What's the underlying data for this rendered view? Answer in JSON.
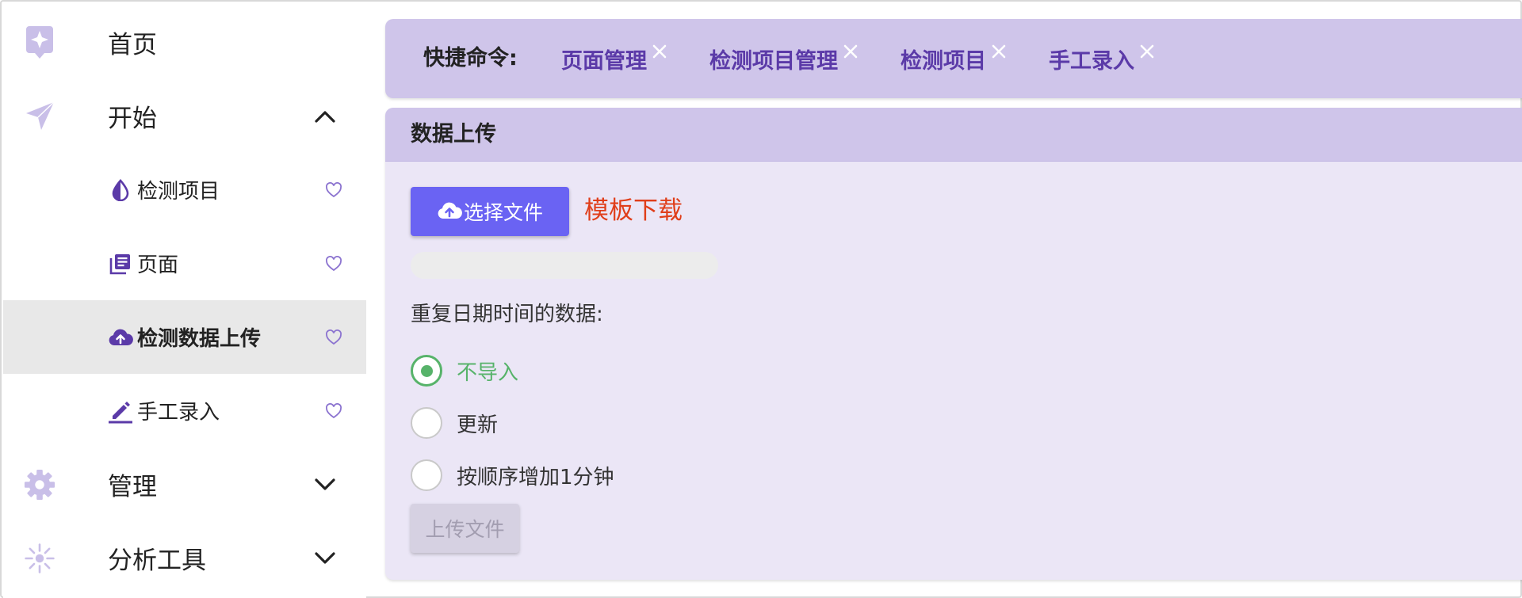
{
  "sidebar": {
    "top_items": [
      {
        "label": "首页",
        "icon": "sparkle-badge-icon"
      },
      {
        "label": "开始",
        "icon": "send-arrow-icon",
        "expanded": true
      },
      {
        "label": "管理",
        "icon": "gear-icon",
        "expanded": false
      },
      {
        "label": "分析工具",
        "icon": "sun-burst-icon",
        "expanded": false
      }
    ],
    "sub_items": [
      {
        "label": "检测项目",
        "icon": "contrast-drop-icon",
        "active": false
      },
      {
        "label": "页面",
        "icon": "library-books-icon",
        "active": false
      },
      {
        "label": "检测数据上传",
        "icon": "cloud-upload-icon",
        "active": true
      },
      {
        "label": "手工录入",
        "icon": "edit-pen-icon",
        "active": false
      }
    ]
  },
  "quickbar": {
    "label": "快捷命令:",
    "tabs": [
      {
        "label": "页面管理"
      },
      {
        "label": "检测项目管理"
      },
      {
        "label": "检测项目"
      },
      {
        "label": "手工录入"
      }
    ]
  },
  "panel": {
    "title": "数据上传",
    "choose_button": "选择文件",
    "template_link": "模板下载",
    "progress_percent": 0,
    "duplicate_label": "重复日期时间的数据:",
    "options": [
      {
        "label": "不导入",
        "selected": true
      },
      {
        "label": "更新",
        "selected": false
      },
      {
        "label": "按顺序增加1分钟",
        "selected": false
      }
    ],
    "upload_button": "上传文件"
  },
  "colors": {
    "accent_purple": "#5b3aa8",
    "icon_lilac": "#c9bfe8",
    "header_lilac": "#cfc5ea",
    "panel_bg": "#ebe6f6",
    "primary_button": "#6a63f3",
    "link_red": "#e03e1a",
    "radio_green": "#57b36a",
    "disabled_button": "#d6d1e2"
  }
}
